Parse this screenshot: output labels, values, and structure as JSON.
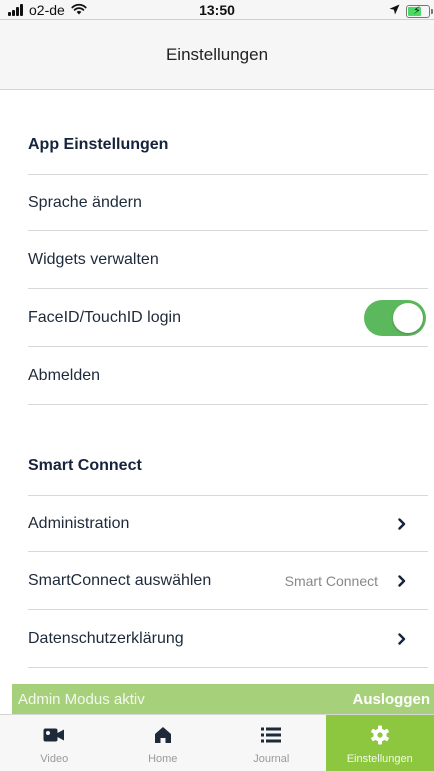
{
  "status_bar": {
    "carrier": "o2-de",
    "time": "13:50"
  },
  "nav": {
    "title": "Einstellungen"
  },
  "sections": {
    "app": {
      "header": "App Einstellungen",
      "language": "Sprache ändern",
      "widgets": "Widgets verwalten",
      "faceid": "FaceID/TouchID login",
      "faceid_enabled": true,
      "logout": "Abmelden"
    },
    "smart_connect": {
      "header": "Smart Connect",
      "administration": "Administration",
      "select": "SmartConnect auswählen",
      "select_value": "Smart Connect",
      "privacy": "Datenschutzerklärung"
    }
  },
  "admin_banner": {
    "text": "Admin Modus aktiv",
    "action": "Ausloggen"
  },
  "tabs": [
    {
      "label": "Video",
      "icon": "video-camera-icon"
    },
    {
      "label": "Home",
      "icon": "home-icon"
    },
    {
      "label": "Journal",
      "icon": "list-icon"
    },
    {
      "label": "Einstellungen",
      "icon": "gear-icon",
      "active": true
    }
  ],
  "colors": {
    "accent_green": "#8dc63f",
    "toggle_green": "#5cb85c",
    "banner_green": "#a7d07a",
    "heading_navy": "#15233b"
  }
}
